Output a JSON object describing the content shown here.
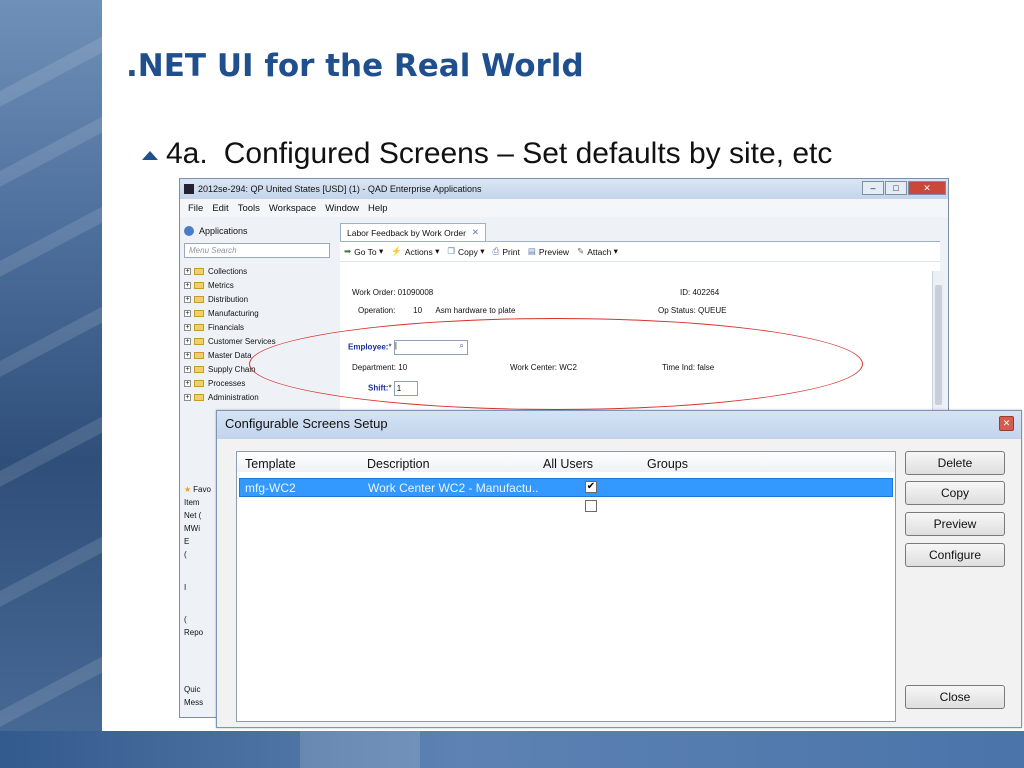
{
  "slide": {
    "title": ".NET UI for the Real World",
    "bullet_number": "4a.",
    "bullet_text": "Configured Screens – Set defaults by site, etc"
  },
  "app": {
    "window_title": "2012se-294: QP United States [USD] (1) - QAD Enterprise Applications",
    "menu": [
      "File",
      "Edit",
      "Tools",
      "Workspace",
      "Window",
      "Help"
    ],
    "nav": {
      "applications_label": "Applications",
      "search_placeholder": "Menu Search",
      "tree": [
        "Collections",
        "Metrics",
        "Distribution",
        "Manufacturing",
        "Financials",
        "Customer Services",
        "Master Data",
        "Supply Chain",
        "Processes",
        "Administration"
      ],
      "lower_items": [
        "Favo",
        "Item",
        "Net (",
        "MWi",
        "E",
        "(",
        "I",
        "(",
        "Repo",
        "Quic",
        "Mess"
      ]
    },
    "tab_label": "Labor Feedback by Work Order",
    "toolbar": {
      "goto": "Go To",
      "actions": "Actions",
      "copy": "Copy",
      "print": "Print",
      "preview": "Preview",
      "attach": "Attach"
    },
    "form": {
      "work_order_label": "Work Order:",
      "work_order_value": "01090008",
      "id_label": "ID:",
      "id_value": "402264",
      "operation_label": "Operation:",
      "operation_value": "10",
      "operation_desc": "Asm hardware to plate",
      "op_status_label": "Op Status:",
      "op_status_value": "QUEUE",
      "employee_label": "Employee:",
      "employee_value": "|",
      "department_label": "Department:",
      "department_value": "10",
      "work_center_label": "Work Center:",
      "work_center_value": "WC2",
      "time_ind_label": "Time Ind:",
      "time_ind_value": "false",
      "shift_label": "Shift:",
      "shift_value": "1"
    }
  },
  "dialog": {
    "title": "Configurable Screens Setup",
    "columns": [
      "Template",
      "Description",
      "All Users",
      "Groups"
    ],
    "rows": [
      {
        "template": "mfg-WC2",
        "description": "Work Center WC2 - Manufactu..",
        "all_users": true,
        "groups": ""
      },
      {
        "template": "",
        "description": "",
        "all_users": false,
        "groups": ""
      }
    ],
    "buttons": {
      "delete": "Delete",
      "copy": "Copy",
      "preview": "Preview",
      "configure": "Configure",
      "close": "Close"
    }
  },
  "colors": {
    "title_blue": "#1f4f8c",
    "selection": "#3399ff",
    "annotation_ellipse": "#d8322d"
  }
}
